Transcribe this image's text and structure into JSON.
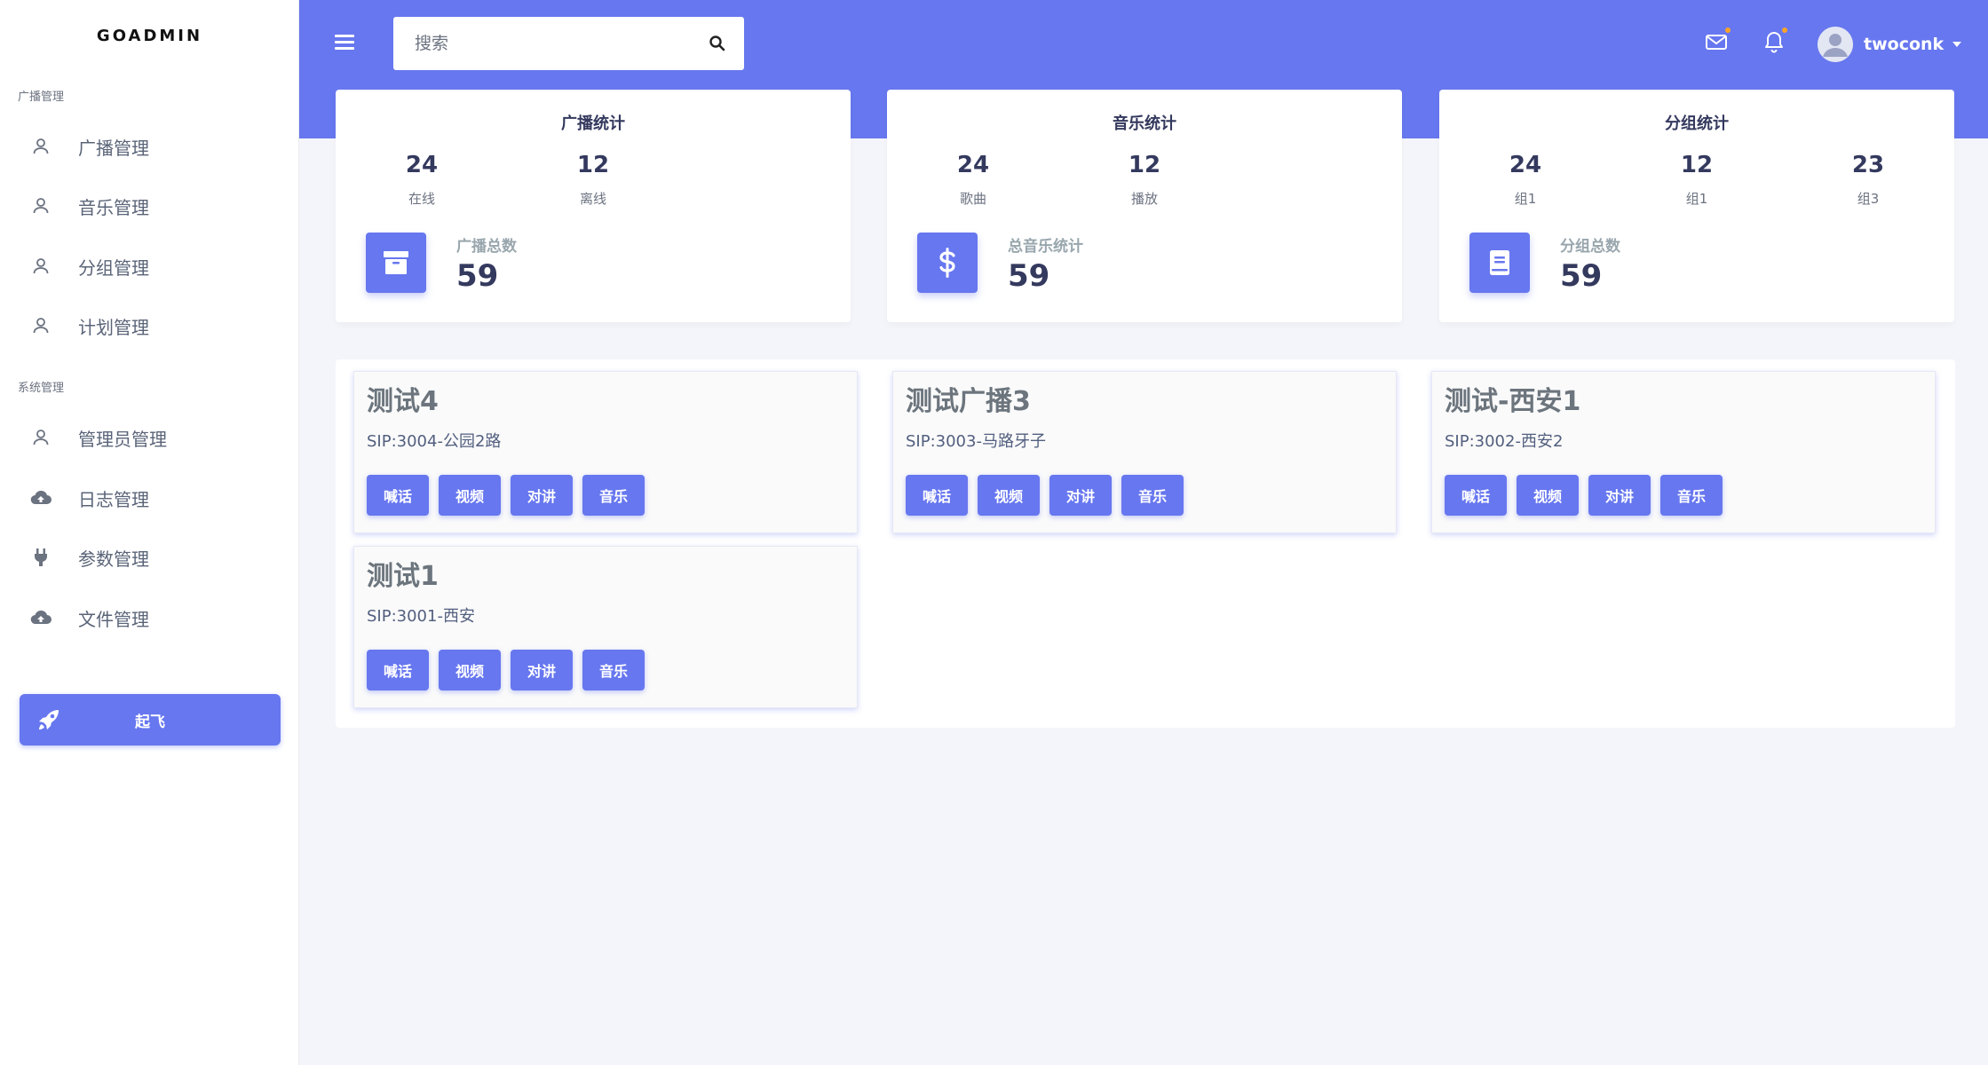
{
  "brand": "GOADMIN",
  "sidebar": {
    "sections": [
      {
        "title": "广播管理"
      },
      {
        "title": "系统管理"
      }
    ],
    "items": [
      {
        "label": "广播管理",
        "icon": "user-icon"
      },
      {
        "label": "音乐管理",
        "icon": "user-icon"
      },
      {
        "label": "分组管理",
        "icon": "user-icon"
      },
      {
        "label": "计划管理",
        "icon": "user-icon"
      },
      {
        "label": "管理员管理",
        "icon": "user-icon"
      },
      {
        "label": "日志管理",
        "icon": "cloud-upload-icon"
      },
      {
        "label": "参数管理",
        "icon": "plug-icon"
      },
      {
        "label": "文件管理",
        "icon": "cloud-upload-icon"
      }
    ],
    "launch_button": {
      "label": "起飞",
      "icon": "rocket-icon"
    }
  },
  "header": {
    "search": {
      "placeholder": "搜索",
      "value": ""
    },
    "user": {
      "name": "twoconk"
    }
  },
  "stats": [
    {
      "title": "广播统计",
      "metrics": [
        {
          "value": "24",
          "label": "在线"
        },
        {
          "value": "12",
          "label": "离线"
        }
      ],
      "total_label": "广播总数",
      "total": "59",
      "icon": "archive-icon"
    },
    {
      "title": "音乐统计",
      "metrics": [
        {
          "value": "24",
          "label": "歌曲"
        },
        {
          "value": "12",
          "label": "播放"
        }
      ],
      "total_label": "总音乐统计",
      "total": "59",
      "icon": "dollar-icon"
    },
    {
      "title": "分组统计",
      "metrics": [
        {
          "value": "24",
          "label": "组1"
        },
        {
          "value": "12",
          "label": "组1"
        },
        {
          "value": "23",
          "label": "组3"
        }
      ],
      "total_label": "分组总数",
      "total": "59",
      "icon": "book-icon"
    }
  ],
  "devices": [
    {
      "name": "测试4",
      "sip": "SIP:3004-公园2路"
    },
    {
      "name": "测试广播3",
      "sip": "SIP:3003-马路牙子"
    },
    {
      "name": "测试-西安1",
      "sip": "SIP:3002-西安2"
    },
    {
      "name": "测试1",
      "sip": "SIP:3001-西安"
    }
  ],
  "device_actions": [
    "喊话",
    "视频",
    "对讲",
    "音乐"
  ],
  "colors": {
    "primary": "#6777ef",
    "notification_dot": "#ffa426"
  }
}
